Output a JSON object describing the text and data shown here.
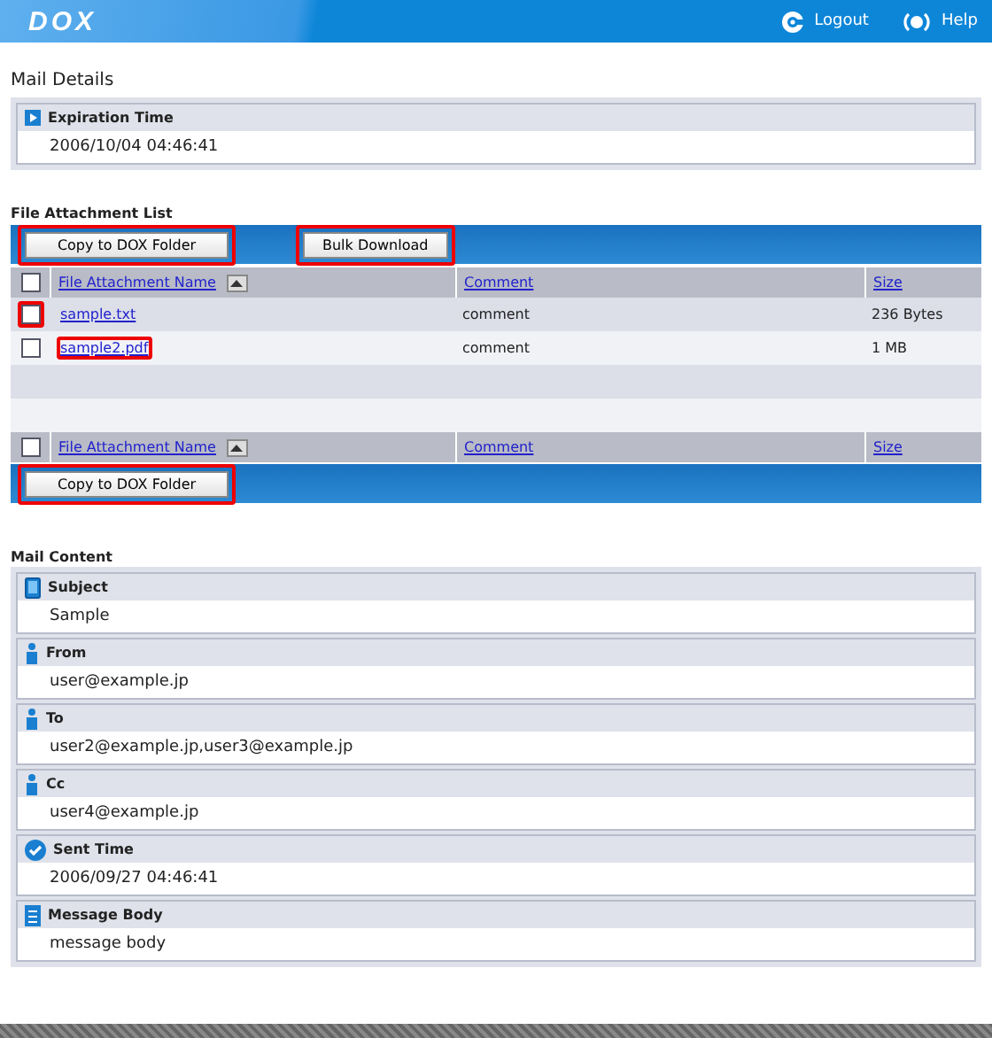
{
  "header": {
    "logo": "DOX",
    "links": [
      {
        "kind": "logout",
        "label": "Logout"
      },
      {
        "kind": "help",
        "label": "Help"
      }
    ]
  },
  "mail_details": {
    "title": "Mail Details",
    "fields": [
      {
        "label": "Expiration Time",
        "value": "2006/10/04 04:46:41"
      }
    ]
  },
  "attachments": {
    "title": "File Attachment List",
    "top_buttons": [
      {
        "label": "Copy to DOX Folder",
        "highlighted": true
      },
      {
        "label": "Bulk Download",
        "highlighted": true
      }
    ],
    "header_top": {
      "select_all_checked": false,
      "columns": [
        {
          "label": "File Attachment Name",
          "sort": true
        },
        {
          "label": "Comment",
          "sort": false
        },
        {
          "label": "Size",
          "sort": false
        }
      ]
    },
    "rows": [
      {
        "name": "sample.txt",
        "comment": "comment",
        "size": "236 Bytes",
        "checked": false,
        "checkbox_highlighted": true,
        "name_highlighted": false
      },
      {
        "name": "sample2.pdf",
        "comment": "comment",
        "size": "1 MB",
        "checked": false,
        "checkbox_highlighted": false,
        "name_highlighted": true
      }
    ],
    "header_bottom": {
      "select_all_checked": false,
      "columns": [
        {
          "label": "File Attachment Name",
          "sort": true
        },
        {
          "label": "Comment",
          "sort": false
        },
        {
          "label": "Size",
          "sort": false
        }
      ]
    },
    "bottom_buttons": [
      {
        "label": "Copy to DOX Folder",
        "highlighted": true
      }
    ]
  },
  "mail_content": {
    "title": "Mail Content",
    "fields": [
      {
        "kind": "subject",
        "label": "Subject",
        "value": "Sample"
      },
      {
        "kind": "address",
        "label": "From",
        "value": "user@example.jp"
      },
      {
        "kind": "address",
        "label": "To",
        "value": "user2@example.jp,user3@example.jp"
      },
      {
        "kind": "address",
        "label": "Cc",
        "value": "user4@example.jp"
      },
      {
        "kind": "time",
        "label": "Sent Time",
        "value": "2006/09/27 04:46:41"
      },
      {
        "kind": "body",
        "label": "Message Body",
        "value": "message body"
      }
    ]
  }
}
